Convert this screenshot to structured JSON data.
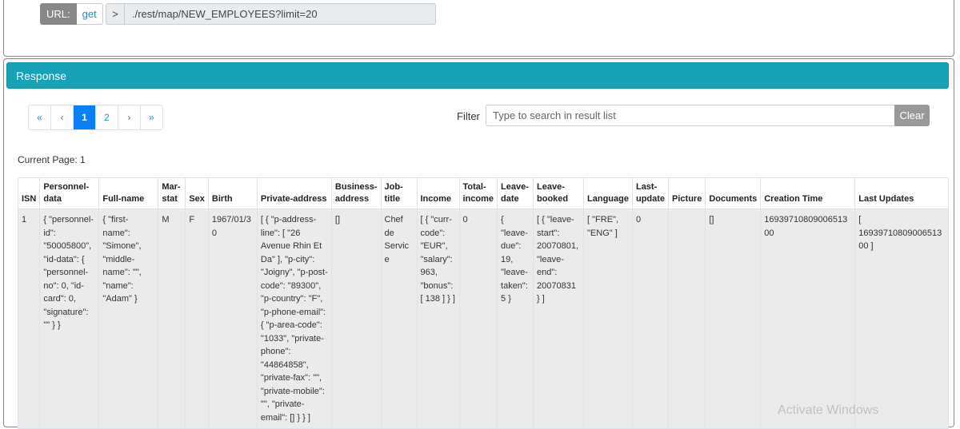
{
  "request": {
    "url_label": "URL:",
    "method": "get",
    "caret": ">",
    "path": "./rest/map/NEW_EMPLOYEES?limit=20"
  },
  "response": {
    "title": "Response",
    "pagination": [
      "«",
      "‹",
      "1",
      "2",
      "›",
      "»"
    ],
    "active_page": "1",
    "filter": {
      "label": "Filter",
      "placeholder": "Type to search in result list",
      "value": "",
      "clear_label": "Clear"
    },
    "current_page_text": "Current Page: 1",
    "columns": [
      "ISN",
      "Personnel-data",
      "Full-name",
      "Mar-stat",
      "Sex",
      "Birth",
      "Private-address",
      "Business-address",
      "Job-title",
      "Income",
      "Total-income",
      "Leave-date",
      "Leave-booked",
      "Language",
      "Last-update",
      "Picture",
      "Documents",
      "Creation Time",
      "Last Updates"
    ],
    "rows": [
      [
        "1",
        "{ \"personnel-id\": \"50005800\", \"id-data\": { \"personnel-no\": 0, \"id-card\": 0, \"signature\": \"\" } }",
        "{ \"first-name\": \"Simone\", \"middle-name\": \"\", \"name\": \"Adam\" }",
        "M",
        "F",
        "1967/01/30",
        "[ { \"p-address-line\": [ \"26 Avenue Rhin Et Da\" ], \"p-city\": \"Joigny\", \"p-post-code\": \"89300\", \"p-country\": \"F\", \"p-phone-email\": { \"p-area-code\": \"1033\", \"private-phone\": \"44864858\", \"private-fax\": \"\", \"private-mobile\": \"\", \"private-email\": [] } } ]",
        "[]",
        "Chef de Service",
        "[ { \"curr-code\": \"EUR\", \"salary\": 963, \"bonus\": [ 138 ] } ]",
        "0",
        "{ \"leave-due\": 19, \"leave-taken\": 5 }",
        "[ { \"leave-start\": 20070801, \"leave-end\": 20070831 } ]",
        "[ \"FRE\", \"ENG\" ]",
        "0",
        "",
        "[]",
        "1693971080900651300",
        "[ 1693971080900651300 ]"
      ]
    ]
  },
  "overlay": {
    "watermark": "Activate Windows"
  }
}
